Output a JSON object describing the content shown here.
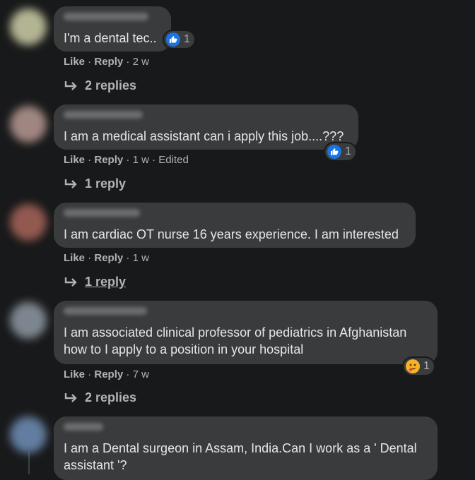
{
  "comments": [
    {
      "text": "I'm a dental tec..",
      "reaction_count": "1",
      "like_label": "Like",
      "reply_label": "Reply",
      "time": "2 w",
      "replies_label": "2 replies"
    },
    {
      "text": "I am a medical assistant can i apply this job....???",
      "reaction_count": "1",
      "like_label": "Like",
      "reply_label": "Reply",
      "time": "1 w",
      "edited": "Edited",
      "replies_label": "1 reply"
    },
    {
      "text": "I am cardiac OT nurse 16 years experience. I am interested",
      "like_label": "Like",
      "reply_label": "Reply",
      "time": "1 w",
      "replies_label": "1 reply"
    },
    {
      "text_lines": [
        "I am associated clinical professor of pediatrics in Afghanistan",
        "how to I apply to a position in your hospital"
      ],
      "reaction_count": "1",
      "like_label": "Like",
      "reply_label": "Reply",
      "time": "7 w",
      "replies_label": "2 replies"
    },
    {
      "text_lines": [
        "I am a Dental surgeon in Assam, India.Can I work as a ' Dental",
        "assistant '?"
      ]
    }
  ],
  "colors": {
    "background": "#18191a",
    "bubble": "#3a3b3c",
    "like_blue": "#1b74e4",
    "care_yellow": "#f7b125",
    "muted_text": "#b0b3b8"
  }
}
